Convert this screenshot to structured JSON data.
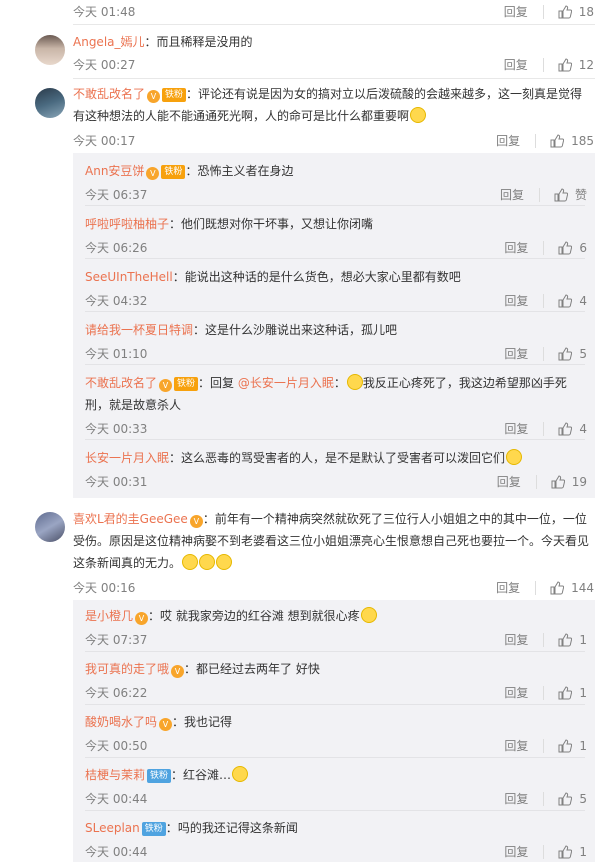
{
  "ui": {
    "reply": "回复",
    "fan_badge": "铁粉",
    "at_prefix": "回复 "
  },
  "comments": [
    {
      "user": "",
      "text": "",
      "time": "今天 01:48",
      "likes": "18"
    },
    {
      "user": "Angela_嫣儿",
      "text": "而且稀释是没用的",
      "time": "今天 00:27",
      "likes": "12"
    },
    {
      "user": "不敢乱改名了",
      "text": "评论还有说是因为女的搞对立以后泼硫酸的会越来越多，这一刻真是觉得有这种想法的人能不能通通死光啊，人的命可是比什么都重要啊",
      "time": "今天 00:17",
      "likes": "185",
      "replies": [
        {
          "user": "Ann安豆饼",
          "text": "恐怖主义者在身边",
          "time": "今天 06:37",
          "likes": "赞"
        },
        {
          "user": "呼啦呼啦柚柚子",
          "text": "他们既想对你干坏事，又想让你闭嘴",
          "time": "今天 06:26",
          "likes": "6"
        },
        {
          "user": "SeeUInTheHell",
          "text": "能说出这种话的是什么货色，想必大家心里都有数吧",
          "time": "今天 04:32",
          "likes": "4"
        },
        {
          "user": "请给我一杯夏日特调",
          "text": "这是什么沙雕说出来这种话，孤儿吧",
          "time": "今天 01:10",
          "likes": "5"
        },
        {
          "user": "不敢乱改名了",
          "mention": "@长安一片月入眠",
          "text": "我反正心疼死了，我这边希望那凶手死刑，就是故意杀人",
          "time": "今天 00:33",
          "likes": "4"
        },
        {
          "user": "长安一片月入眠",
          "text": "这么恶毒的骂受害者的人，是不是默认了受害者可以泼回它们",
          "time": "今天 00:31",
          "likes": "19"
        }
      ]
    },
    {
      "user": "喜欢L君的圭GeeGee",
      "text": "前年有一个精神病突然就砍死了三位行人小姐姐之中的其中一位，一位受伤。原因是这位精神病娶不到老婆看这三位小姐姐漂亮心生恨意想自己死也要拉一个。今天看见这条新闻真的无力。",
      "time": "今天 00:16",
      "likes": "144",
      "replies": [
        {
          "user": "是小橙几",
          "text": "哎 就我家旁边的红谷滩 想到就很心疼",
          "time": "今天 07:37",
          "likes": "1"
        },
        {
          "user": "我可真的走了哦",
          "text": "都已经过去两年了 好快",
          "time": "今天 06:22",
          "likes": "1"
        },
        {
          "user": "酸奶喝水了吗",
          "text": "我也记得",
          "time": "今天 00:50",
          "likes": "1"
        },
        {
          "user": "桔梗与茉莉",
          "text": "红谷滩…",
          "time": "今天 00:44",
          "likes": "5"
        },
        {
          "user": "SLeeplan",
          "text": "吗的我还记得这条新闻",
          "time": "今天 00:44",
          "likes": "1"
        }
      ]
    }
  ],
  "colors": {
    "username": "#eb7350",
    "meta": "#808080",
    "reply_bg": "#f2f2f5"
  }
}
